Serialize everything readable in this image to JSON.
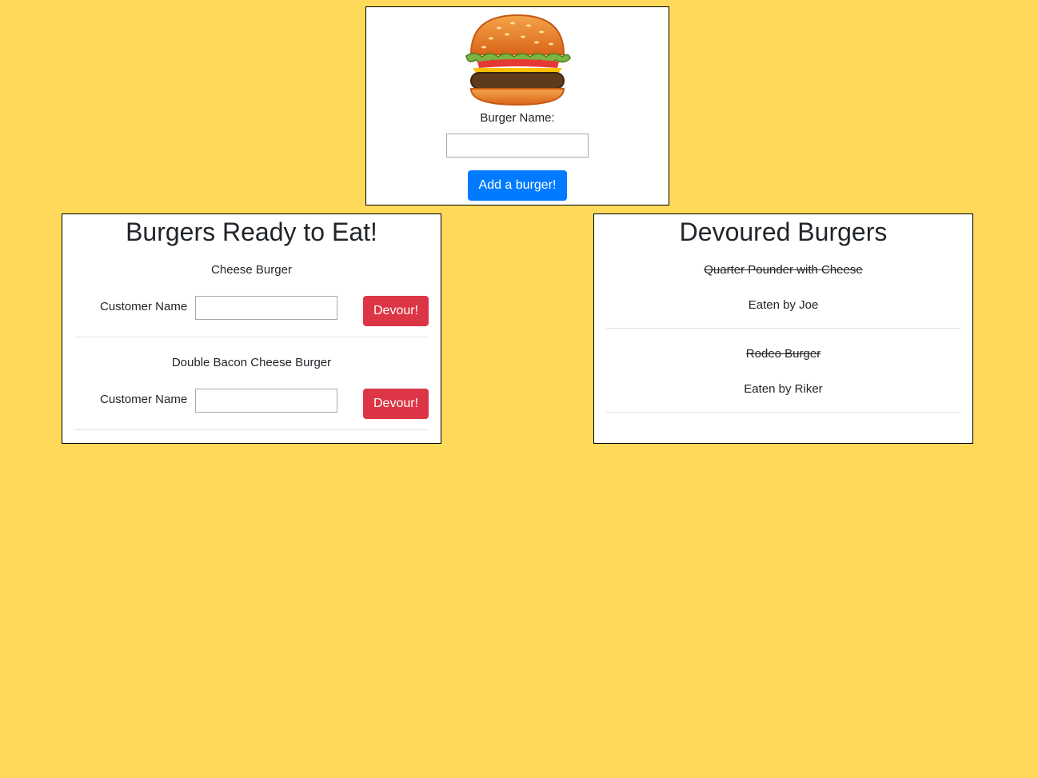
{
  "add_form": {
    "logo_icon": "hamburger-icon",
    "label": "Burger Name:",
    "input_value": "",
    "button_label": "Add a burger!"
  },
  "ready": {
    "title": "Burgers Ready to Eat!",
    "items": [
      {
        "name": "Cheese Burger",
        "customer_label": "Customer Name",
        "customer_value": "",
        "button_label": "Devour!"
      },
      {
        "name": "Double Bacon Cheese Burger",
        "customer_label": "Customer Name",
        "customer_value": "",
        "button_label": "Devour!"
      }
    ]
  },
  "devoured": {
    "title": "Devoured Burgers",
    "items": [
      {
        "name": "Quarter Pounder with Cheese",
        "eaten_by": "Eaten by Joe"
      },
      {
        "name": "Rodeo Burger",
        "eaten_by": "Eaten by Riker"
      }
    ]
  },
  "colors": {
    "background": "#FFDA5A",
    "primary_button": "#007bff",
    "danger_button": "#dc3545"
  }
}
